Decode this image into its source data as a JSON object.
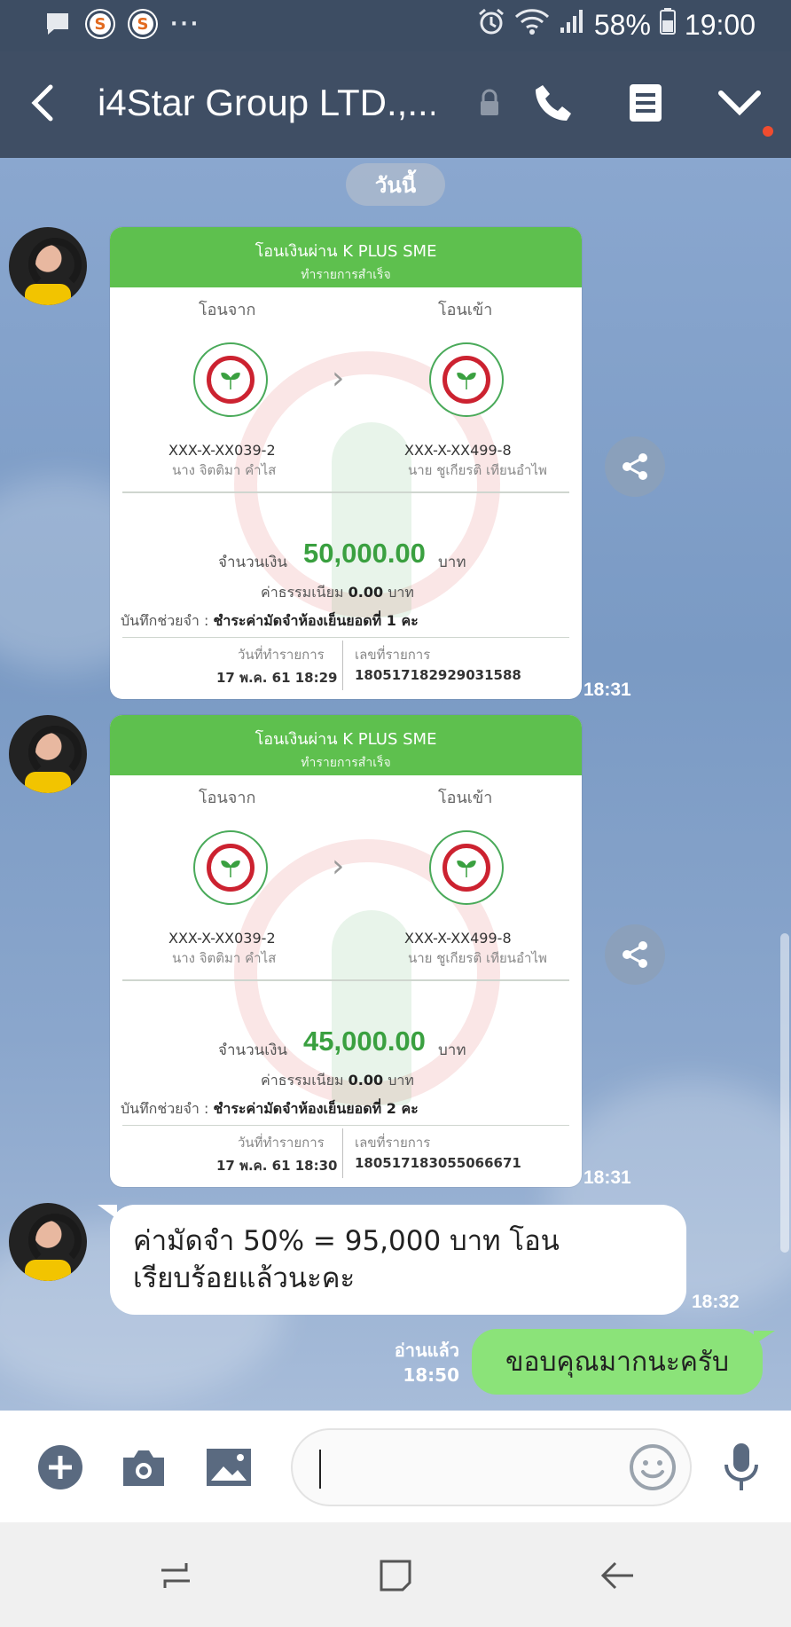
{
  "status_bar": {
    "battery": "58%",
    "time": "19:00",
    "notif_badge_1": "S",
    "notif_badge_2": "S",
    "more": "···"
  },
  "header": {
    "title": "i4Star Group LTD.,..."
  },
  "chat": {
    "date_label": "วันนี้",
    "receipts": [
      {
        "header_title": "โอนเงินผ่าน K PLUS SME",
        "header_sub": "ทำรายการสำเร็จ",
        "from_label": "โอนจาก",
        "to_label": "โอนเข้า",
        "from_account": "XXX-X-XX039-2",
        "from_name": "นาง จิตติมา คำไส",
        "to_account": "XXX-X-XX499-8",
        "to_name": "นาย ชูเกียรติ เทียนอำไพ",
        "amount_label": "จำนวนเงิน",
        "amount": "50,000.00",
        "amount_unit": "บาท",
        "fee_label": "ค่าธรรมเนียม",
        "fee": "0.00",
        "fee_unit": "บาท",
        "memo_label": "บันทึกช่วยจำ :",
        "memo": "ชำระค่ามัดจำห้องเย็นยอดที่ 1 คะ",
        "date_label": "วันที่ทำรายการ",
        "date": "17 พ.ค. 61 18:29",
        "ref_label": "เลขที่รายการ",
        "ref": "180517182929031588",
        "time": "18:31"
      },
      {
        "header_title": "โอนเงินผ่าน K PLUS SME",
        "header_sub": "ทำรายการสำเร็จ",
        "from_label": "โอนจาก",
        "to_label": "โอนเข้า",
        "from_account": "XXX-X-XX039-2",
        "from_name": "นาง จิตติมา คำไส",
        "to_account": "XXX-X-XX499-8",
        "to_name": "นาย ชูเกียรติ เทียนอำไพ",
        "amount_label": "จำนวนเงิน",
        "amount": "45,000.00",
        "amount_unit": "บาท",
        "fee_label": "ค่าธรรมเนียม",
        "fee": "0.00",
        "fee_unit": "บาท",
        "memo_label": "บันทึกช่วยจำ :",
        "memo": "ชำระค่ามัดจำห้องเย็นยอดที่ 2 คะ",
        "date_label": "วันที่ทำรายการ",
        "date": "17 พ.ค. 61 18:30",
        "ref_label": "เลขที่รายการ",
        "ref": "180517183055066671",
        "time": "18:31"
      }
    ],
    "incoming_text": {
      "line1": "ค่ามัดจำ 50% = 95,000 บาท โอน",
      "line2": "เรียบร้อยแล้วนะคะ",
      "time": "18:32"
    },
    "outgoing_text": {
      "text": "ขอบคุณมากนะครับ",
      "read_label": "อ่านแล้ว",
      "time": "18:50"
    }
  },
  "input": {
    "value": "",
    "placeholder": ""
  },
  "colors": {
    "header_bg": "#3f4e64",
    "receipt_green": "#5ec04e",
    "amount_green": "#3aa040",
    "outgoing_bubble": "#8be379",
    "notif_dot": "#f04c2f"
  }
}
